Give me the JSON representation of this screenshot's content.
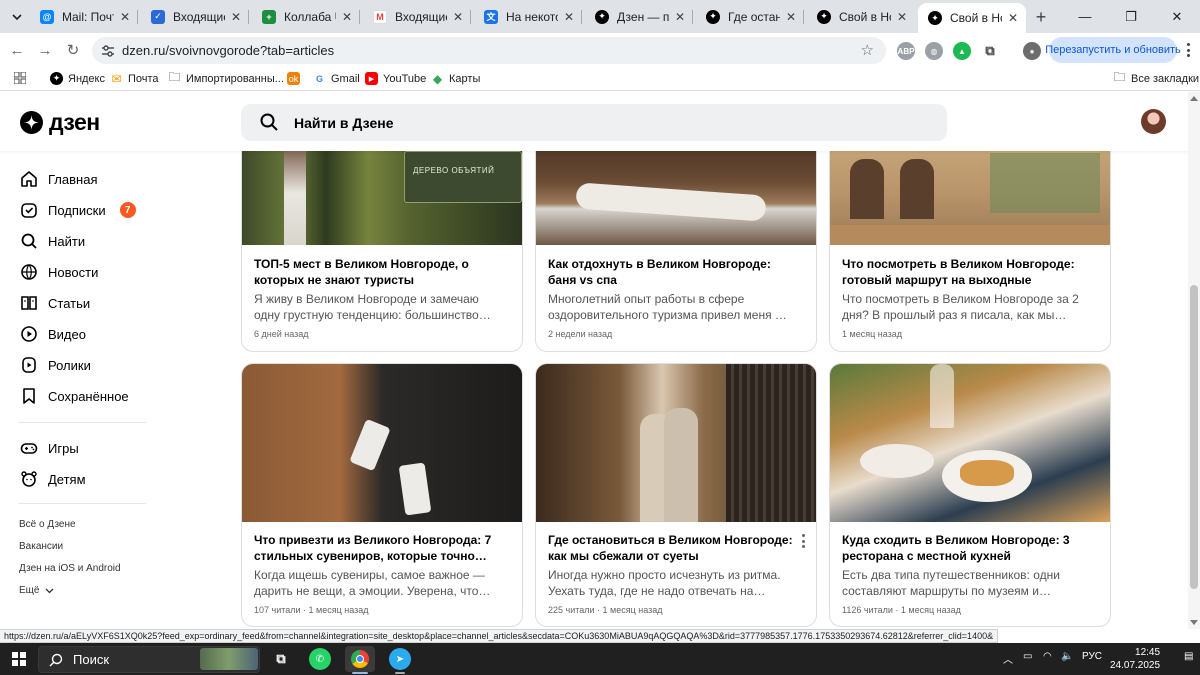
{
  "browser": {
    "tabs": [
      {
        "title": "Mail: Почта, ",
        "icon": "mail-ru-icon",
        "color": "#0a84ff"
      },
      {
        "title": "Входящие - ",
        "icon": "mail-inbox-icon",
        "color": "#2a6ad6"
      },
      {
        "title": "Коллаба UzC",
        "icon": "sheets-icon",
        "color": "#1e8e3e"
      },
      {
        "title": "Входящие - ",
        "icon": "gmail-icon",
        "color": "#ea4335"
      },
      {
        "title": "На некоторых",
        "icon": "translate-icon",
        "color": "#1a73e8"
      },
      {
        "title": "Дзен — плат",
        "icon": "dzen-icon",
        "color": "#000000"
      },
      {
        "title": "Где останови",
        "icon": "dzen-icon",
        "color": "#000000"
      },
      {
        "title": "Свой в Новг",
        "icon": "dzen-icon",
        "color": "#000000"
      },
      {
        "title": "Свой в Новг",
        "icon": "dzen-icon",
        "color": "#000000",
        "active": true
      }
    ],
    "url": "dzen.ru/svoivnovgorode?tab=articles",
    "restart_label": "Перезапустить и обновить",
    "bookmarks": [
      {
        "label": "Яндекс",
        "icon": "dzen-icon"
      },
      {
        "label": "Почта",
        "icon": "mail-icon"
      },
      {
        "label": "Импортированны...",
        "icon": "folder-icon"
      },
      {
        "label": "",
        "icon": "ok-icon"
      },
      {
        "label": "Gmail",
        "icon": "google-icon"
      },
      {
        "label": "YouTube",
        "icon": "youtube-icon"
      },
      {
        "label": "Карты",
        "icon": "maps-icon"
      }
    ],
    "all_bookmarks_label": "Все закладки",
    "status_url": "https://dzen.ru/a/aELyVXF6S1XQ0k25?feed_exp=ordinary_feed&from=channel&integration=site_desktop&place=channel_articles&secdata=COKu3630MiABUA9qAQGQAQA%3D&rid=3777985357.1776.1753350293674.62812&referrer_clid=1400&"
  },
  "dzen": {
    "logo_text": "дзен",
    "search_placeholder": "Найти в Дзене",
    "nav": [
      {
        "label": "Главная",
        "icon": "home-icon"
      },
      {
        "label": "Подписки",
        "icon": "subscriptions-icon",
        "badge": "7"
      },
      {
        "label": "Найти",
        "icon": "search-icon"
      },
      {
        "label": "Новости",
        "icon": "news-icon"
      },
      {
        "label": "Статьи",
        "icon": "articles-icon"
      },
      {
        "label": "Видео",
        "icon": "video-icon"
      },
      {
        "label": "Ролики",
        "icon": "shorts-icon"
      },
      {
        "label": "Сохранённое",
        "icon": "bookmark-icon"
      }
    ],
    "nav2": [
      {
        "label": "Игры",
        "icon": "gamepad-icon"
      },
      {
        "label": "Детям",
        "icon": "kids-icon"
      }
    ],
    "footer_links": [
      "Всё о Дзене",
      "Вакансии",
      "Дзен на iOS и Android",
      "Ещё"
    ],
    "cards": [
      {
        "title": "ТОП-5 мест в Великом Новгороде, о которых не знают туристы",
        "desc": "Я живу в Великом Новгороде и замечаю одну грустную тенденцию: большинство…",
        "meta": "6 дней назад",
        "sign": "ДЕРЕВО ОБЪЯТИЙ"
      },
      {
        "title": "Как отдохнуть в Великом Новгороде: баня vs спа",
        "desc": "Многолетний опыт работы в сфере оздоровительного туризма привел меня …",
        "meta": "2 недели назад"
      },
      {
        "title": "Что посмотреть в Великом Новгороде: готовый маршрут на выходные",
        "desc": "Что посмотреть в Великом Новгороде за 2 дня? В прошлый раз я писала, как мы…",
        "meta": "1 месяц назад"
      },
      {
        "title": "Что привезти из Великого Новгорода: 7 стильных сувениров, которые точно…",
        "desc": "Когда ищешь сувениры, самое важное — дарить не вещи, а эмоции. Уверена, что…",
        "meta": "107 читали · 1 месяц назад"
      },
      {
        "title": "Где остановиться в Великом Новгороде: как мы сбежали от суеты",
        "desc": "Иногда нужно просто исчезнуть из ритма. Уехать туда, где не надо отвечать на…",
        "meta": "225 читали · 1 месяц назад"
      },
      {
        "title": "Куда сходить в Великом Новгороде: 3 ресторана с местной кухней",
        "desc": "Есть два типа путешественников: одни составляют маршруты по музеям и…",
        "meta": "1126 читали · 1 месяц назад"
      }
    ]
  },
  "taskbar": {
    "search_label": "Поиск",
    "lang": "РУС",
    "time": "12:45",
    "date": "24.07.2025"
  }
}
